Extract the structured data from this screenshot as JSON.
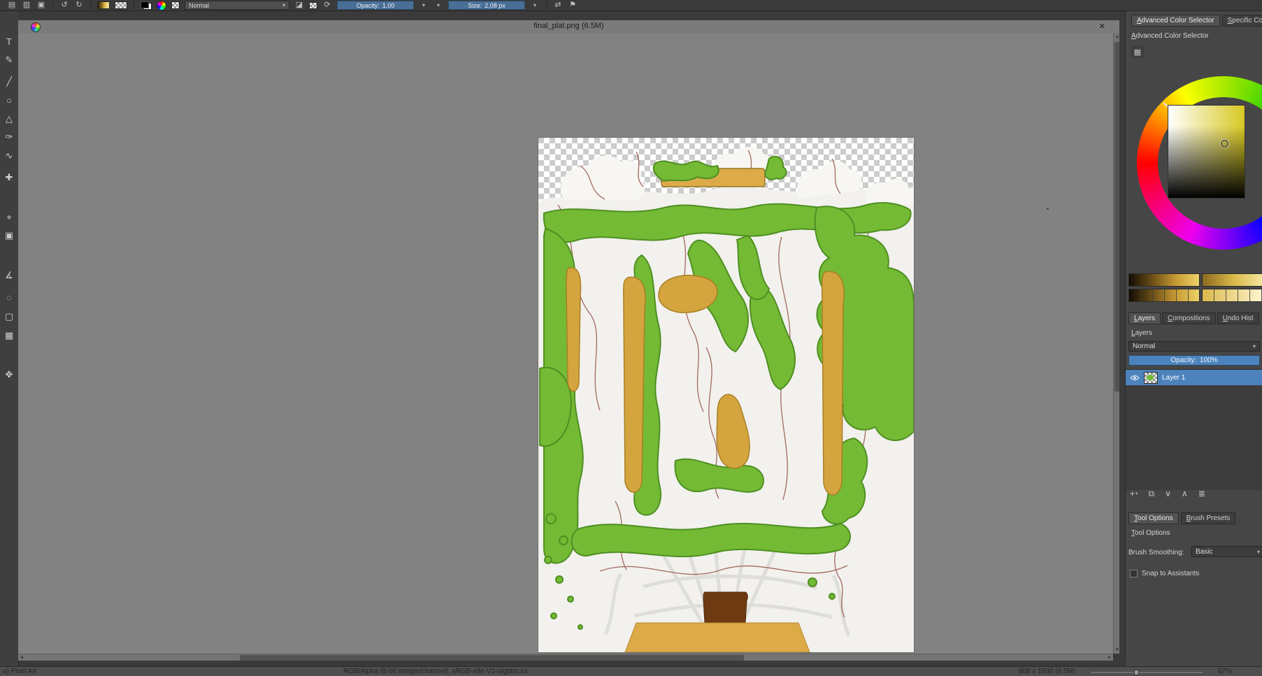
{
  "palette": {
    "accent_blue": "#4c83bc",
    "canvas_bg": "#828282",
    "panel_bg": "#464646",
    "map_green": "#74ba34",
    "map_tan": "#d4a53e"
  },
  "icons": {
    "caret_down": "▾",
    "scroll_up": "▲",
    "scroll_down": "▼",
    "scroll_left": "◄",
    "scroll_right": "►",
    "close": "✕",
    "new": "▤",
    "open": "▥",
    "save": "▣",
    "undo": "↺",
    "redo": "↻",
    "eraser": "◪",
    "reload": "⟳",
    "mirror": "⇄",
    "wrap": "⚑",
    "grid": "▦",
    "layer_add": "+",
    "layer_duplicate": "⧉",
    "layer_down": "∨",
    "layer_up": "∧",
    "layer_props": "≣"
  },
  "top_toolbar": {
    "blend_mode": "Normal",
    "opacity_label": "Opacity:",
    "opacity_value": "1,00",
    "size_label": "Size:",
    "size_value": "2,08 px"
  },
  "toolbox": {
    "tools": [
      {
        "id": "text",
        "glyph": "T"
      },
      {
        "id": "edit-shapes",
        "glyph": "✎"
      },
      {
        "id": "line",
        "glyph": "╱"
      },
      {
        "id": "ellipse",
        "glyph": "○"
      },
      {
        "id": "polygon",
        "glyph": "△"
      },
      {
        "id": "bezier",
        "glyph": "✑"
      },
      {
        "id": "freehand",
        "glyph": "∿"
      },
      {
        "id": "move",
        "glyph": "✚"
      },
      {
        "id": "color-sampler",
        "glyph": "⌖"
      },
      {
        "id": "smart-patch",
        "glyph": "▣"
      },
      {
        "id": "measure",
        "glyph": "∡"
      },
      {
        "id": "select-outline",
        "glyph": "◌"
      },
      {
        "id": "select-rect",
        "glyph": "▢"
      },
      {
        "id": "select-contiguous",
        "glyph": "▦"
      },
      {
        "id": "pan",
        "glyph": "✥"
      }
    ]
  },
  "document": {
    "title": "final_plat.png (6.5M)"
  },
  "right_panel": {
    "top_tabs": [
      {
        "label": "Advanced Color Selector"
      },
      {
        "label": "Specific Co"
      }
    ],
    "color_docker_title": "Advanced Color Selector",
    "docker_tabs": [
      {
        "label": "Layers"
      },
      {
        "label": "Compositions"
      },
      {
        "label": "Undo Hist"
      }
    ],
    "layers": {
      "title": "Layers",
      "blend_mode": "Normal",
      "opacity_label": "Opacity:",
      "opacity_value": "100%",
      "rows": [
        {
          "name": "Layer 1"
        }
      ]
    },
    "bottom_tabs": [
      {
        "label": "Tool Options"
      },
      {
        "label": "Brush Presets"
      }
    ],
    "tool_options": {
      "title": "Tool Options",
      "smoothing_label": "Brush Smoothing:",
      "smoothing_value": "Basic",
      "snap_label": "Snap to Assistants"
    }
  },
  "statusbar": {
    "brush": "u) Pixel Art",
    "profile": "RGB/Alpha (8-bit integer/channel), sRGB-elle-V2-srgbtrc.icc",
    "dimensions": "808 x 1600 (6.5M)",
    "zoom": "67%"
  }
}
